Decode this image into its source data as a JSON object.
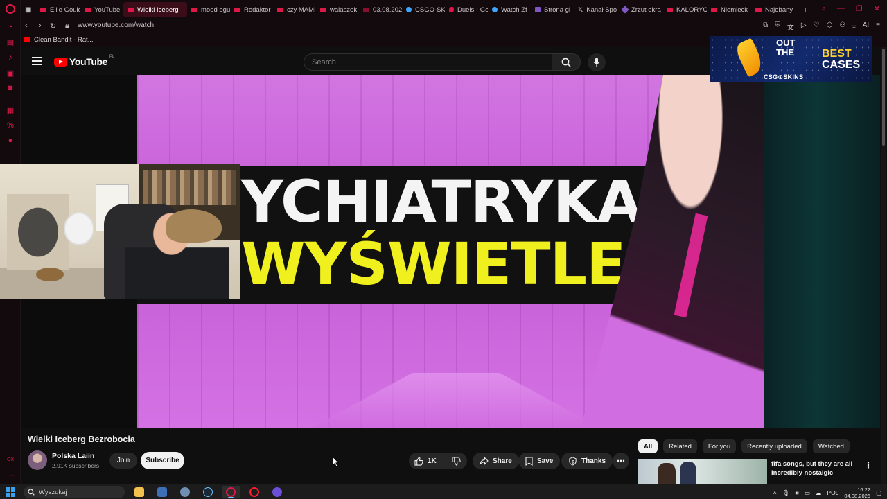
{
  "browser": {
    "tabs": [
      {
        "label": "Ellie Gould",
        "icon": "youtube-icon"
      },
      {
        "label": "YouTube",
        "icon": "youtube-icon"
      },
      {
        "label": "Wielki Iceberg",
        "icon": "speaker-icon",
        "active": true
      },
      {
        "label": "mood ogu",
        "icon": "youtube-icon"
      },
      {
        "label": "Redaktor",
        "icon": "youtube-icon"
      },
      {
        "label": "czy MAMI",
        "icon": "youtube-icon"
      },
      {
        "label": "walaszek",
        "icon": "youtube-icon"
      },
      {
        "label": "03.08.202",
        "icon": "bookmark-icon"
      },
      {
        "label": "CSGO-SK",
        "icon": "globe-icon"
      },
      {
        "label": "Duels - Ge",
        "icon": "pin-icon"
      },
      {
        "label": "Watch Zf",
        "icon": "globe-icon"
      },
      {
        "label": "Strona gł",
        "icon": "app-icon"
      },
      {
        "label": "Kanał Spo",
        "icon": "x-icon"
      },
      {
        "label": "Zrzut ekra",
        "icon": "pen-icon"
      },
      {
        "label": "KALORYC",
        "icon": "youtube-icon"
      },
      {
        "label": "Niemieck",
        "icon": "youtube-icon"
      },
      {
        "label": "Najebany",
        "icon": "youtube-icon"
      }
    ],
    "url": "www.youtube.com/watch",
    "bookmark": "Clean Bandit - Rat...",
    "ext_ai_label": "AI"
  },
  "youtube": {
    "logo_text": "YouTube",
    "country_code": "PL",
    "search_placeholder": "Search"
  },
  "ad": {
    "line1": "OUT",
    "line2": "THE",
    "best": "BEST",
    "cases": "CASES",
    "brand": "CSG⊙SKINS"
  },
  "video": {
    "thumbnail_line1": "YCHIATRYKA",
    "thumbnail_line2": "WYŚWIETLEŃ",
    "title": "Wielki Iceberg Bezrobocia",
    "channel": "Polska Laiin",
    "subscribers": "2.91K subscribers",
    "join_label": "Join",
    "subscribe_label": "Subscribe",
    "likes": "1K",
    "share_label": "Share",
    "save_label": "Save",
    "thanks_label": "Thanks"
  },
  "chips": [
    "All",
    "Related",
    "For you",
    "Recently uploaded",
    "Watched"
  ],
  "recommendation": {
    "title": "fifa songs, but they are all incredibly nostalgic"
  },
  "taskbar": {
    "search_label": "Wyszukaj",
    "language": "POL",
    "time": "16:22",
    "date": "04.08.2026"
  },
  "colors": {
    "accent": "#e0184a",
    "youtube_red": "#ff0000",
    "thumbnail_purple": "#d06de0",
    "thumbnail_yellow": "#f0f01e"
  }
}
